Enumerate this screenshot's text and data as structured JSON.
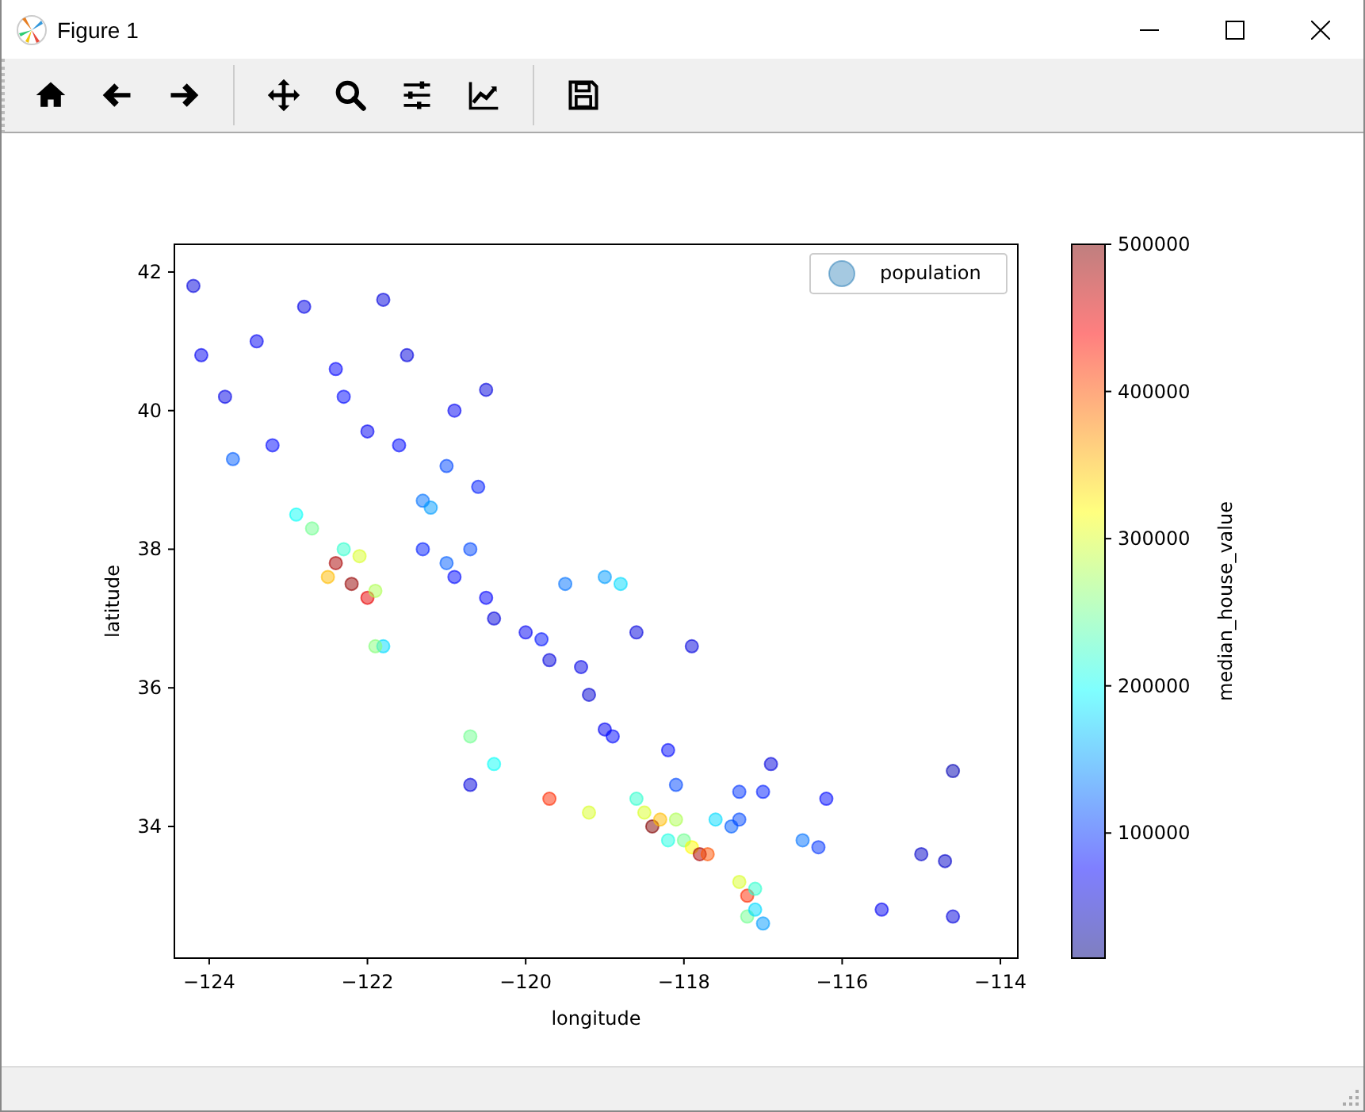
{
  "window": {
    "title": "Figure 1",
    "controls": [
      {
        "kind": "minimize"
      },
      {
        "kind": "maximize"
      },
      {
        "kind": "close"
      }
    ]
  },
  "toolbar": [
    {
      "kind": "home"
    },
    {
      "kind": "back"
    },
    {
      "kind": "forward"
    },
    {
      "kind": "separator"
    },
    {
      "kind": "pan"
    },
    {
      "kind": "zoom"
    },
    {
      "kind": "configure"
    },
    {
      "kind": "edit"
    },
    {
      "kind": "separator"
    },
    {
      "kind": "save"
    }
  ],
  "figure": {
    "chart_data": {
      "type": "scatter",
      "xlabel": "longitude",
      "ylabel": "latitude",
      "xlim": [
        -124.44,
        -113.78
      ],
      "ylim": [
        32.1,
        42.4
      ],
      "xticks": [
        -124,
        -122,
        -120,
        -118,
        -116,
        -114
      ],
      "yticks": [
        34,
        36,
        38,
        40,
        42
      ],
      "x": [
        -124.2,
        -124.1,
        -123.8,
        -123.2,
        -122.4,
        -122.0,
        -121.6,
        -121.3,
        -121.0,
        -120.6,
        -121.8,
        -122.8,
        -120.5,
        -120.9,
        -121.5,
        -123.4,
        -122.3,
        -123.7,
        -122.4,
        -122.2,
        -122.0,
        -122.5,
        -122.1,
        -121.9,
        -122.7,
        -122.9,
        -121.8,
        -121.9,
        -122.3,
        -121.3,
        -120.9,
        -120.5,
        -120.0,
        -119.8,
        -119.3,
        -119.0,
        -120.4,
        -121.0,
        -119.7,
        -119.2,
        -118.9,
        -120.7,
        -121.2,
        -119.5,
        -118.6,
        -120.7,
        -120.4,
        -119.7,
        -119.2,
        -120.7,
        -118.4,
        -118.3,
        -118.1,
        -118.0,
        -117.9,
        -117.8,
        -117.4,
        -117.3,
        -117.6,
        -118.5,
        -118.6,
        -118.2,
        -117.7,
        -117.2,
        -117.1,
        -117.0,
        -117.2,
        -117.3,
        -117.1,
        -116.5,
        -116.2,
        -115.5,
        -116.3,
        -117.0,
        -117.3,
        -115.0,
        -114.6,
        -114.7,
        -114.6,
        -116.9,
        -118.1,
        -118.2,
        -118.8,
        -119.0,
        -117.9
      ],
      "series": [
        {
          "name": "population",
          "color": "#1f77b4",
          "values": [
            41.8,
            40.8,
            40.2,
            39.5,
            40.6,
            39.7,
            39.5,
            38.7,
            39.2,
            38.9,
            41.6,
            41.5,
            40.3,
            40.0,
            40.8,
            41.0,
            40.2,
            39.3,
            37.8,
            37.5,
            37.3,
            37.6,
            37.9,
            37.4,
            38.3,
            38.5,
            36.6,
            36.6,
            38.0,
            38.0,
            37.6,
            37.3,
            36.8,
            36.7,
            36.3,
            35.4,
            37.0,
            37.8,
            36.4,
            35.9,
            35.3,
            38.0,
            38.6,
            37.5,
            36.8,
            35.3,
            34.9,
            34.4,
            34.2,
            34.6,
            34.0,
            34.1,
            34.1,
            33.8,
            33.7,
            33.6,
            34.0,
            34.1,
            34.1,
            34.2,
            34.4,
            33.8,
            33.6,
            32.7,
            32.8,
            32.6,
            33.0,
            33.2,
            33.1,
            33.8,
            34.4,
            32.8,
            33.7,
            34.5,
            34.5,
            33.6,
            34.8,
            33.5,
            32.7,
            34.9,
            34.6,
            35.1,
            37.5,
            37.6,
            36.6
          ],
          "colors": [
            "#0000de",
            "#0000f3",
            "#0000e8",
            "#0009ff",
            "#0000fe",
            "#0000f3",
            "#0009ff",
            "#0072ff",
            "#0048ff",
            "#001eff",
            "#0000de",
            "#0000e8",
            "#0000de",
            "#0000f3",
            "#0000de",
            "#0000f3",
            "#0009ff",
            "#005dff",
            "#a90000",
            "#950000",
            "#e80000",
            "#ffbc00",
            "#d9ff26",
            "#aeff50",
            "#70ff8f",
            "#07fff8",
            "#00dbff",
            "#85ff7a",
            "#30ffce",
            "#001eff",
            "#0009ff",
            "#0000fe",
            "#0000f3",
            "#0014ff",
            "#0000e8",
            "#0000f3",
            "#0000de",
            "#005dff",
            "#0000de",
            "#0000d4",
            "#0009ff",
            "#0048ff",
            "#009cff",
            "#0072ff",
            "#0000de",
            "#70ff8f",
            "#07fff8",
            "#ff2900",
            "#d9ff26",
            "#0000de",
            "#800000",
            "#ffbc00",
            "#aeff50",
            "#70ff8f",
            "#fffb00",
            "#a90000",
            "#005dff",
            "#0048ff",
            "#00dbff",
            "#d9ff26",
            "#30ffce",
            "#1cffe3",
            "#ff5300",
            "#70ff8f",
            "#00dbff",
            "#009cff",
            "#ff2900",
            "#d9ff26",
            "#30ffce",
            "#0072ff",
            "#0009ff",
            "#0000f3",
            "#0033ff",
            "#001eff",
            "#0033ff",
            "#0000c9",
            "#0000b4",
            "#0000c9",
            "#0000de",
            "#0000de",
            "#0048ff",
            "#0009ff",
            "#00dbff",
            "#009cff",
            "#0000de"
          ]
        }
      ]
    },
    "colorbar": {
      "label": "median_house_value",
      "ticks": [
        "500000",
        "400000",
        "300000",
        "200000",
        "100000"
      ]
    }
  }
}
